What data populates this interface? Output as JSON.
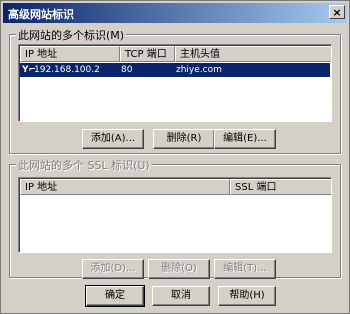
{
  "window": {
    "title": "高级网站标识",
    "close_label": "×"
  },
  "identities": {
    "legend": "此网站的多个标识(M)",
    "columns": [
      "IP 地址",
      "TCP 端口",
      "主机头值"
    ],
    "rows": [
      {
        "icon": "Υ⌐",
        "ip": "192.168.100.2",
        "port": "80",
        "host": "zhiye.com"
      }
    ],
    "buttons": {
      "add": "添加(A)...",
      "remove": "删除(R)",
      "edit": "编辑(E)..."
    }
  },
  "ssl": {
    "legend": "此网站的多个 SSL 标识(U)",
    "columns": [
      "IP 地址",
      "SSL 端口"
    ],
    "buttons": {
      "add": "添加(D)...",
      "remove": "删除(O)",
      "edit": "编辑(T)..."
    }
  },
  "footer": {
    "ok": "确定",
    "cancel": "取消",
    "help": "帮助(H)"
  },
  "colors": {
    "selection": "#0a246a",
    "face": "#d4d0c8"
  }
}
